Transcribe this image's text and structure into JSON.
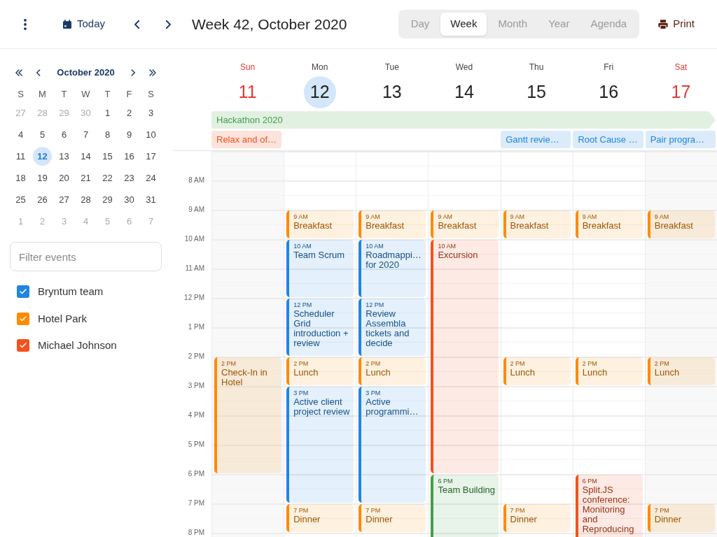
{
  "toolbar": {
    "today": "Today",
    "title": "Week 42, October 2020",
    "views": [
      {
        "label": "Day",
        "selected": false
      },
      {
        "label": "Week",
        "selected": true
      },
      {
        "label": "Month",
        "selected": false
      },
      {
        "label": "Year",
        "selected": false
      },
      {
        "label": "Agenda",
        "selected": false
      }
    ],
    "print": "Print"
  },
  "mini_calendar": {
    "month": "October 2020",
    "weekdays": [
      "S",
      "M",
      "T",
      "W",
      "T",
      "F",
      "S"
    ],
    "weeks": [
      [
        {
          "label": "27",
          "other_month": true,
          "selected": false
        },
        {
          "label": "28",
          "other_month": true,
          "selected": false
        },
        {
          "label": "29",
          "other_month": true,
          "selected": false
        },
        {
          "label": "30",
          "other_month": true,
          "selected": false
        },
        {
          "label": "1",
          "other_month": false,
          "selected": false
        },
        {
          "label": "2",
          "other_month": false,
          "selected": false
        },
        {
          "label": "3",
          "other_month": false,
          "selected": false
        }
      ],
      [
        {
          "label": "4",
          "other_month": false,
          "selected": false
        },
        {
          "label": "5",
          "other_month": false,
          "selected": false
        },
        {
          "label": "6",
          "other_month": false,
          "selected": false
        },
        {
          "label": "7",
          "other_month": false,
          "selected": false
        },
        {
          "label": "8",
          "other_month": false,
          "selected": false
        },
        {
          "label": "9",
          "other_month": false,
          "selected": false
        },
        {
          "label": "10",
          "other_month": false,
          "selected": false
        }
      ],
      [
        {
          "label": "11",
          "other_month": false,
          "selected": false
        },
        {
          "label": "12",
          "other_month": false,
          "selected": true
        },
        {
          "label": "13",
          "other_month": false,
          "selected": false
        },
        {
          "label": "14",
          "other_month": false,
          "selected": false
        },
        {
          "label": "15",
          "other_month": false,
          "selected": false
        },
        {
          "label": "16",
          "other_month": false,
          "selected": false
        },
        {
          "label": "17",
          "other_month": false,
          "selected": false
        }
      ],
      [
        {
          "label": "18",
          "other_month": false,
          "selected": false
        },
        {
          "label": "19",
          "other_month": false,
          "selected": false
        },
        {
          "label": "20",
          "other_month": false,
          "selected": false
        },
        {
          "label": "21",
          "other_month": false,
          "selected": false
        },
        {
          "label": "22",
          "other_month": false,
          "selected": false
        },
        {
          "label": "23",
          "other_month": false,
          "selected": false
        },
        {
          "label": "24",
          "other_month": false,
          "selected": false
        }
      ],
      [
        {
          "label": "25",
          "other_month": false,
          "selected": false
        },
        {
          "label": "26",
          "other_month": false,
          "selected": false
        },
        {
          "label": "27",
          "other_month": false,
          "selected": false
        },
        {
          "label": "28",
          "other_month": false,
          "selected": false
        },
        {
          "label": "29",
          "other_month": false,
          "selected": false
        },
        {
          "label": "30",
          "other_month": false,
          "selected": false
        },
        {
          "label": "31",
          "other_month": false,
          "selected": false
        }
      ],
      [
        {
          "label": "1",
          "other_month": true,
          "selected": false
        },
        {
          "label": "2",
          "other_month": true,
          "selected": false
        },
        {
          "label": "3",
          "other_month": true,
          "selected": false
        },
        {
          "label": "4",
          "other_month": true,
          "selected": false
        },
        {
          "label": "5",
          "other_month": true,
          "selected": false
        },
        {
          "label": "6",
          "other_month": true,
          "selected": false
        },
        {
          "label": "7",
          "other_month": true,
          "selected": false
        }
      ]
    ]
  },
  "filter": {
    "placeholder": "Filter events"
  },
  "calendars": [
    {
      "label": "Bryntum team",
      "checked": true,
      "color": "#2185e0"
    },
    {
      "label": "Hotel Park",
      "checked": true,
      "color": "#ff8a00"
    },
    {
      "label": "Michael Johnson",
      "checked": true,
      "color": "#f4511e"
    }
  ],
  "days": [
    {
      "name": "Sun",
      "date": "11",
      "weekend": true,
      "today": false
    },
    {
      "name": "Mon",
      "date": "12",
      "weekend": false,
      "today": true
    },
    {
      "name": "Tue",
      "date": "13",
      "weekend": false,
      "today": false
    },
    {
      "name": "Wed",
      "date": "14",
      "weekend": false,
      "today": false
    },
    {
      "name": "Thu",
      "date": "15",
      "weekend": false,
      "today": false
    },
    {
      "name": "Fri",
      "date": "16",
      "weekend": false,
      "today": false
    },
    {
      "name": "Sat",
      "date": "17",
      "weekend": true,
      "today": false
    }
  ],
  "all_day_rows": [
    [
      {
        "kind": "week",
        "title": "Hackathon 2020",
        "color": "#43a047",
        "continues": true
      }
    ],
    [
      {
        "kind": "day",
        "title": "Relax and of…",
        "color": "#f4511e",
        "continues": false
      },
      {
        "kind": "blank"
      },
      {
        "kind": "blank"
      },
      {
        "kind": "blank"
      },
      {
        "kind": "day",
        "title": "Gantt revie…",
        "color": "#2185e0",
        "continues": false
      },
      {
        "kind": "day",
        "title": "Root Cause …",
        "color": "#2185e0",
        "continues": false
      },
      {
        "kind": "day",
        "title": "Pair progra…",
        "color": "#2185e0",
        "continues": false
      }
    ]
  ],
  "hours": [
    "8 AM",
    "9 AM",
    "10 AM",
    "11 AM",
    "12 PM",
    "1 PM",
    "2 PM",
    "3 PM",
    "4 PM",
    "5 PM",
    "6 PM",
    "7 PM",
    "8 PM"
  ],
  "events": [
    [
      {
        "time": "2 PM",
        "title": "Check-In in Hotel",
        "kind": "fourhours",
        "color": "#ff8a00"
      }
    ],
    [
      {
        "time": "9 AM",
        "title": "Breakfast",
        "kind": "hour",
        "color": "#ff8a00"
      },
      {
        "time": "10 AM",
        "title": "Team Scrum",
        "kind": "twohours",
        "color": "#2185e0"
      },
      {
        "time": "12 PM",
        "title": "Scheduler Grid introduction + review",
        "kind": "twohours",
        "color": "#2185e0"
      },
      {
        "time": "2 PM",
        "title": "Lunch",
        "kind": "hour",
        "color": "#ff8a00"
      },
      {
        "time": "3 PM",
        "title": "Active client project review",
        "kind": "fourhours",
        "color": "#2185e0"
      },
      {
        "time": "7 PM",
        "title": "Dinner",
        "kind": "hour",
        "color": "#ff8a00"
      }
    ],
    [
      {
        "time": "9 AM",
        "title": "Breakfast",
        "kind": "hour",
        "color": "#ff8a00"
      },
      {
        "time": "10 AM",
        "title": "Roadmappi… for 2020",
        "kind": "twohours",
        "color": "#2185e0"
      },
      {
        "time": "12 PM",
        "title": "Review Assembla tickets and decide",
        "kind": "twohours",
        "color": "#2185e0"
      },
      {
        "time": "2 PM",
        "title": "Lunch",
        "kind": "hour",
        "color": "#ff8a00"
      },
      {
        "time": "3 PM",
        "title": "Active programmi…",
        "kind": "fourhours",
        "color": "#2185e0"
      },
      {
        "time": "7 PM",
        "title": "Dinner",
        "kind": "hour",
        "color": "#ff8a00"
      }
    ],
    [
      {
        "time": "9 AM",
        "title": "Breakfast",
        "kind": "hour",
        "color": "#ff8a00"
      },
      {
        "time": "10 AM",
        "title": "Excursion",
        "kind": "eighthours",
        "color": "#f4511e"
      },
      {
        "time": "6 PM",
        "title": "Team Building",
        "kind": "threehours",
        "color": "#43a047"
      }
    ],
    [
      {
        "time": "9 AM",
        "title": "Breakfast",
        "kind": "hour",
        "color": "#ff8a00"
      },
      {
        "time": "2 PM",
        "title": "Lunch",
        "kind": "hour",
        "color": "#ff8a00"
      },
      {
        "time": "7 PM",
        "title": "Dinner",
        "kind": "hour",
        "color": "#ff8a00"
      }
    ],
    [
      {
        "time": "9 AM",
        "title": "Breakfast",
        "kind": "hour",
        "color": "#ff8a00"
      },
      {
        "time": "2 PM",
        "title": "Lunch",
        "kind": "hour",
        "color": "#ff8a00"
      },
      {
        "time": "6 PM",
        "title": "Split.JS conference: Monitoring and Reproducing",
        "kind": "threehours",
        "color": "#f4511e"
      }
    ],
    [
      {
        "time": "9 AM",
        "title": "Breakfast",
        "kind": "hour",
        "color": "#ff8a00"
      },
      {
        "time": "2 PM",
        "title": "Lunch",
        "kind": "hour",
        "color": "#ff8a00"
      },
      {
        "time": "7 PM",
        "title": "Dinner",
        "kind": "hour",
        "color": "#ff8a00"
      }
    ]
  ]
}
